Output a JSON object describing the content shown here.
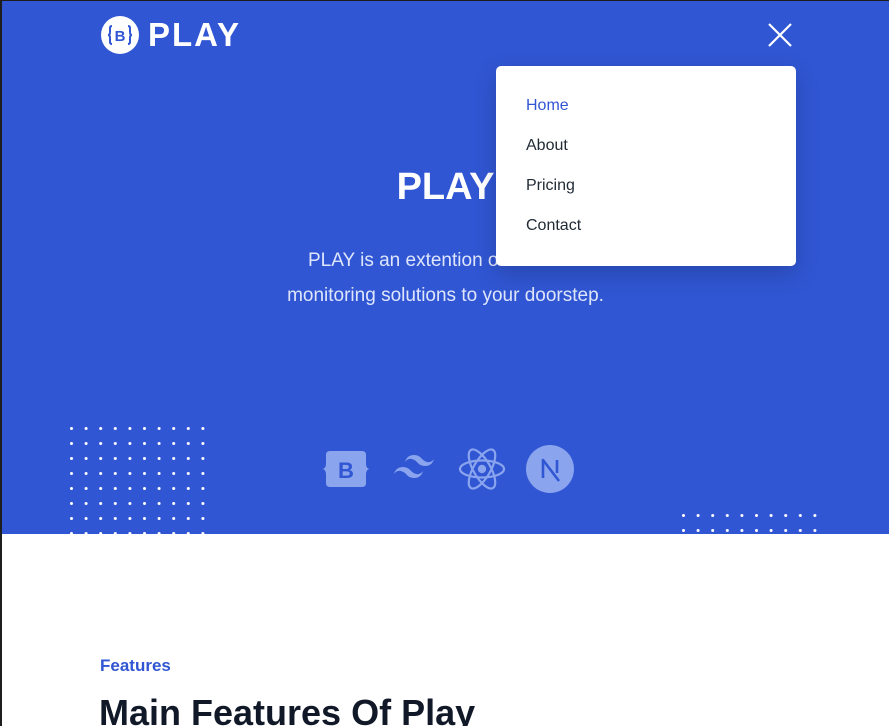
{
  "header": {
    "logo_badge": "B",
    "logo_text": "PLAY"
  },
  "hero": {
    "title": "PLAY",
    "description_line1": "PLAY is an extention of Panda.H",
    "description_line2": "monitoring solutions to your doorstep."
  },
  "nav": {
    "items": [
      {
        "label": "Home",
        "active": true
      },
      {
        "label": "About",
        "active": false
      },
      {
        "label": "Pricing",
        "active": false
      },
      {
        "label": "Contact",
        "active": false
      }
    ]
  },
  "brands": [
    "bootstrap-icon",
    "tailwind-icon",
    "react-icon",
    "nextjs-icon"
  ],
  "features": {
    "tag": "Features",
    "title": "Main Features Of Play"
  },
  "colors": {
    "primary": "#3056d3",
    "heading": "#111928",
    "text": "#212b36",
    "white": "#ffffff"
  }
}
